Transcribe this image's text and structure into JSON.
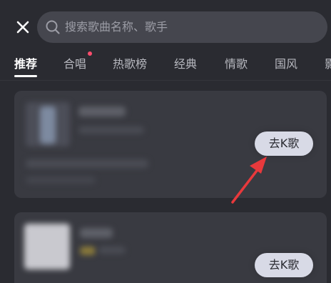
{
  "header": {
    "search_placeholder": "搜索歌曲名称、歌手"
  },
  "tabs": [
    {
      "label": "推荐",
      "active": true
    },
    {
      "label": "合唱",
      "has_dot": true
    },
    {
      "label": "热歌榜"
    },
    {
      "label": "经典"
    },
    {
      "label": "情歌"
    },
    {
      "label": "国风"
    },
    {
      "label": "影"
    }
  ],
  "songs": [
    {
      "action_label": "去K歌"
    },
    {
      "action_label": "去K歌"
    }
  ],
  "colors": {
    "background": "#2a2b31",
    "card": "#393a41",
    "action_button": "#d8dae6",
    "annotation_arrow": "#e8393c",
    "badge_dot": "#ff4d6d"
  },
  "icons": {
    "close": "close-icon",
    "search": "search-icon",
    "annotation": "red-arrow"
  }
}
